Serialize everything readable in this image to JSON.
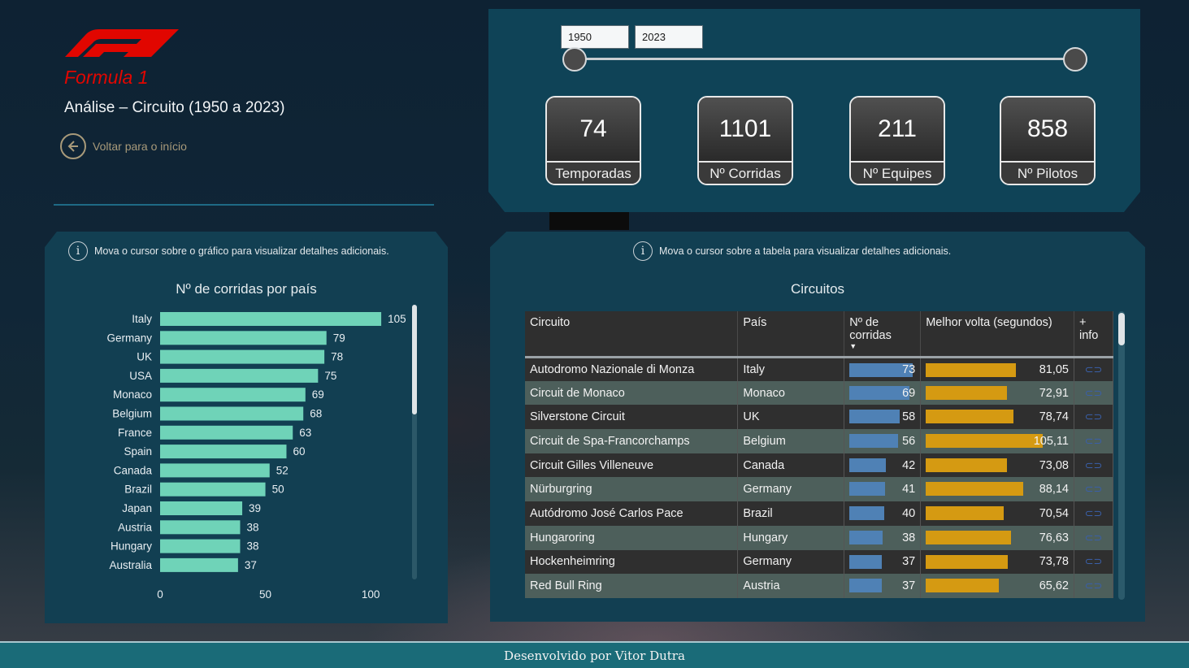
{
  "header": {
    "logo_text": "F1",
    "app_subtitle": "Formula 1",
    "page_title": "Análise – Circuito (1950 a 2023)",
    "back_label": "Voltar para o início"
  },
  "filter": {
    "year_start": "1950",
    "year_end": "2023"
  },
  "kpis": {
    "seasons": {
      "value": "74",
      "label": "Temporadas"
    },
    "races": {
      "value": "1101",
      "label": "Nº Corridas"
    },
    "teams": {
      "value": "211",
      "label": "Nº Equipes"
    },
    "drivers": {
      "value": "858",
      "label": "Nº Pilotos"
    }
  },
  "chart_panel": {
    "hint": "Mova o cursor sobre o gráfico para visualizar detalhes adicionais."
  },
  "chart_data": {
    "type": "bar",
    "orientation": "horizontal",
    "title": "Nº de corridas por país",
    "categories": [
      "Italy",
      "Germany",
      "UK",
      "USA",
      "Monaco",
      "Belgium",
      "France",
      "Spain",
      "Canada",
      "Brazil",
      "Japan",
      "Austria",
      "Hungary",
      "Australia"
    ],
    "values": [
      105,
      79,
      78,
      75,
      69,
      68,
      63,
      60,
      52,
      50,
      39,
      38,
      38,
      37
    ],
    "xlim": [
      0,
      115
    ],
    "xticks": [
      0,
      50,
      100
    ],
    "bar_color": "#6fd3b8",
    "grid": false,
    "data_labels": true
  },
  "table_panel": {
    "hint": "Mova o cursor sobre a tabela para visualizar detalhes adicionais.",
    "title": "Circuitos",
    "columns": [
      "Circuito",
      "País",
      "Nº de corridas",
      "Melhor volta (segundos)",
      "+ info"
    ],
    "rows": [
      {
        "circuit": "Autodromo Nazionale di Monza",
        "country": "Italy",
        "races": 73,
        "best_lap": "81,05",
        "best_lap_value": 81.05
      },
      {
        "circuit": "Circuit de Monaco",
        "country": "Monaco",
        "races": 69,
        "best_lap": "72,91",
        "best_lap_value": 72.91
      },
      {
        "circuit": "Silverstone Circuit",
        "country": "UK",
        "races": 58,
        "best_lap": "78,74",
        "best_lap_value": 78.74
      },
      {
        "circuit": "Circuit de Spa-Francorchamps",
        "country": "Belgium",
        "races": 56,
        "best_lap": "105,11",
        "best_lap_value": 105.11
      },
      {
        "circuit": "Circuit Gilles Villeneuve",
        "country": "Canada",
        "races": 42,
        "best_lap": "73,08",
        "best_lap_value": 73.08
      },
      {
        "circuit": "Nürburgring",
        "country": "Germany",
        "races": 41,
        "best_lap": "88,14",
        "best_lap_value": 88.14
      },
      {
        "circuit": "Autódromo José Carlos Pace",
        "country": "Brazil",
        "races": 40,
        "best_lap": "70,54",
        "best_lap_value": 70.54
      },
      {
        "circuit": "Hungaroring",
        "country": "Hungary",
        "races": 38,
        "best_lap": "76,63",
        "best_lap_value": 76.63
      },
      {
        "circuit": "Hockenheimring",
        "country": "Germany",
        "races": 37,
        "best_lap": "73,78",
        "best_lap_value": 73.78
      },
      {
        "circuit": "Red Bull Ring",
        "country": "Austria",
        "races": 37,
        "best_lap": "65,62",
        "best_lap_value": 65.62
      }
    ],
    "races_bar_color": "#4f81b5",
    "best_lap_bar_color": "#d59a12",
    "link_icon": "link-icon"
  },
  "footer": {
    "credit": "Desenvolvido por Vitor Dutra"
  },
  "colors": {
    "brand_red": "#e10600",
    "panel": "#123f52",
    "footer": "#1a6b78"
  }
}
